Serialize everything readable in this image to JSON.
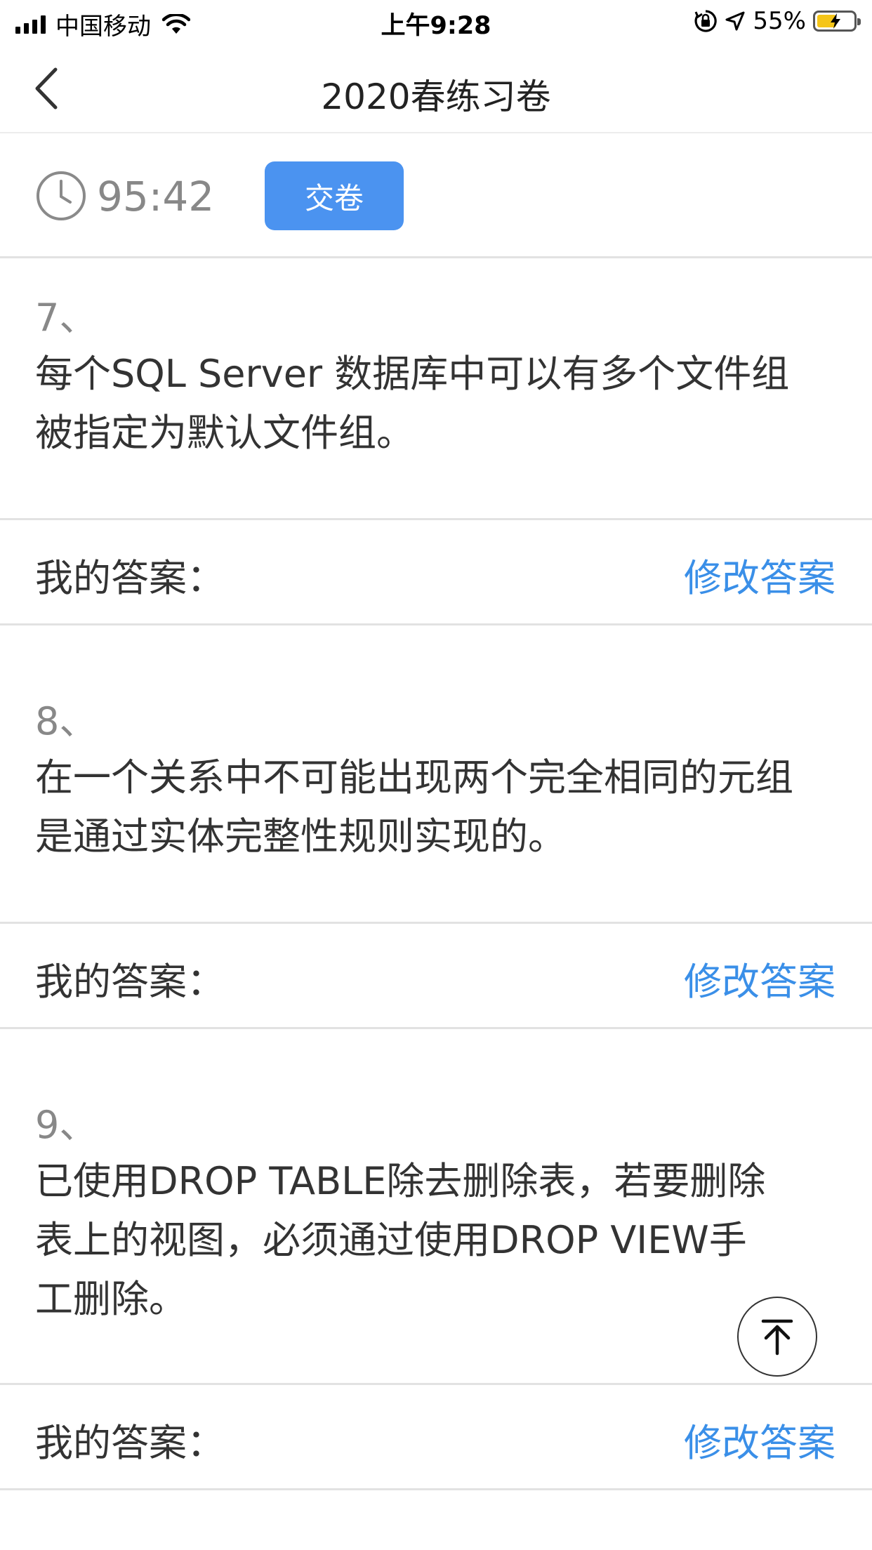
{
  "status_bar": {
    "carrier": "中国移动",
    "time": "上午9:28",
    "battery_percent": "55%",
    "icons": [
      "signal-icon",
      "wifi-icon",
      "orientation-lock-icon",
      "location-icon",
      "battery-charging-icon"
    ]
  },
  "nav": {
    "title": "2020春练习卷",
    "back_icon": "chevron-left-icon"
  },
  "timer": {
    "remaining": "95:42",
    "icon": "clock-icon",
    "submit_label": "交卷",
    "submit_color": "#4b93f0"
  },
  "questions": [
    {
      "number": "7、",
      "lines": [
        "每个SQL Server 数据库中可以有多个文件组",
        "被指定为默认文件组。"
      ],
      "answer_label": "我的答案：",
      "modify_label": "修改答案"
    },
    {
      "number": "8、",
      "lines": [
        "在一个关系中不可能出现两个完全相同的元组",
        "是通过实体完整性规则实现的。"
      ],
      "answer_label": "我的答案：",
      "modify_label": "修改答案"
    },
    {
      "number": "9、",
      "lines": [
        "已使用DROP TABLE除去删除表，若要删除",
        "表上的视图，必须通过使用DROP VIEW手",
        "工删除。"
      ],
      "answer_label": "我的答案：",
      "modify_label": "修改答案"
    }
  ],
  "scroll_top_icon": "arrow-up-to-top-icon",
  "accent_color": "#3a8fe8"
}
